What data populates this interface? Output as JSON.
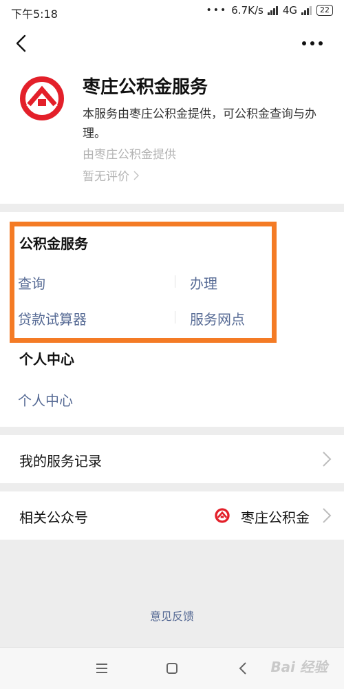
{
  "status_bar": {
    "time": "下午5:18",
    "network_speed": "6.7K/s",
    "network_type": "4G",
    "battery": "22"
  },
  "profile": {
    "title": "枣庄公积金服务",
    "description": "本服务由枣庄公积金提供，可公积金查询与办理。",
    "provider": "由枣庄公积金提供",
    "rating": "暂无评价"
  },
  "sections": {
    "fund": {
      "title": "公积金服务",
      "items": [
        "查询",
        "办理",
        "贷款试算器",
        "服务网点"
      ]
    },
    "personal": {
      "title": "个人中心",
      "items": [
        "个人中心"
      ]
    }
  },
  "records": {
    "label": "我的服务记录"
  },
  "related": {
    "label": "相关公众号",
    "account_name": "枣庄公积金"
  },
  "feedback": {
    "label": "意见反馈"
  },
  "watermark": {
    "text": "Bai 经验"
  },
  "colors": {
    "accent_link": "#576b95",
    "highlight_border": "#f47b25",
    "logo_red": "#e3202a"
  }
}
